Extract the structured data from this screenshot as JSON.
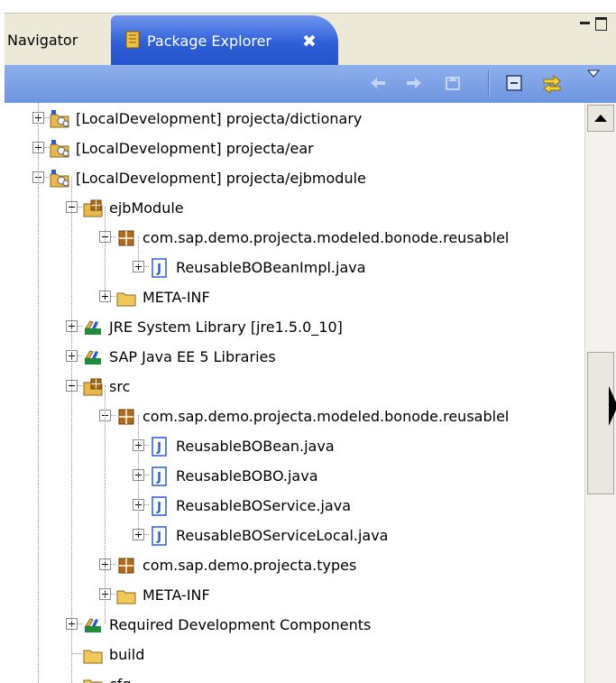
{
  "tabs": {
    "navigator": "Navigator",
    "package_explorer": "Package Explorer",
    "close_glyph": "✖"
  },
  "toolbar": {
    "buttons": [
      "back-icon",
      "forward-icon",
      "up-icon",
      "collapse-all-icon",
      "link-with-editor-icon",
      "view-menu-icon"
    ]
  },
  "colors": {
    "active_tab": "#2e5fd8",
    "toolbar": "#7da3e8",
    "project_icon": "#e8b94a",
    "package_icon": "#b06a1a",
    "java_file_icon": "#2a5bd7",
    "library_icon": "#1e8c3a"
  },
  "tree": {
    "rows": [
      {
        "label": "[LocalDevelopment] projecta/dictionary",
        "icon": "dc-project-icon",
        "expander": "plus"
      },
      {
        "label": "[LocalDevelopment] projecta/ear",
        "icon": "dc-project-icon",
        "expander": "plus"
      },
      {
        "label": "[LocalDevelopment] projecta/ejbmodule",
        "icon": "dc-project-icon",
        "expander": "minus"
      },
      {
        "label": "ejbModule",
        "icon": "source-folder-icon",
        "expander": "minus"
      },
      {
        "label": "com.sap.demo.projecta.modeled.bonode.reusablel",
        "icon": "package-icon",
        "expander": "minus"
      },
      {
        "label": "ReusableBOBeanImpl.java",
        "icon": "java-file-icon",
        "expander": "plus"
      },
      {
        "label": "META-INF",
        "icon": "folder-icon",
        "expander": "plus"
      },
      {
        "label": "JRE System Library [jre1.5.0_10]",
        "icon": "library-icon",
        "expander": "plus"
      },
      {
        "label": "SAP Java EE 5 Libraries",
        "icon": "library-icon",
        "expander": "plus"
      },
      {
        "label": "src",
        "icon": "source-folder-icon",
        "expander": "minus"
      },
      {
        "label": "com.sap.demo.projecta.modeled.bonode.reusablel",
        "icon": "package-icon",
        "expander": "minus"
      },
      {
        "label": "ReusableBOBean.java",
        "icon": "java-file-icon",
        "expander": "plus"
      },
      {
        "label": "ReusableBOBO.java",
        "icon": "java-file-icon",
        "expander": "plus"
      },
      {
        "label": "ReusableBOService.java",
        "icon": "java-file-icon",
        "expander": "plus"
      },
      {
        "label": "ReusableBOServiceLocal.java",
        "icon": "java-file-icon",
        "expander": "plus"
      },
      {
        "label": "com.sap.demo.projecta.types",
        "icon": "package-icon",
        "expander": "plus"
      },
      {
        "label": "META-INF",
        "icon": "folder-icon",
        "expander": "plus"
      },
      {
        "label": "Required Development Components",
        "icon": "library-icon",
        "expander": "plus"
      },
      {
        "label": "build",
        "icon": "folder-icon",
        "expander": "none"
      },
      {
        "label": "cfg",
        "icon": "folder-icon",
        "expander": "none"
      }
    ]
  }
}
